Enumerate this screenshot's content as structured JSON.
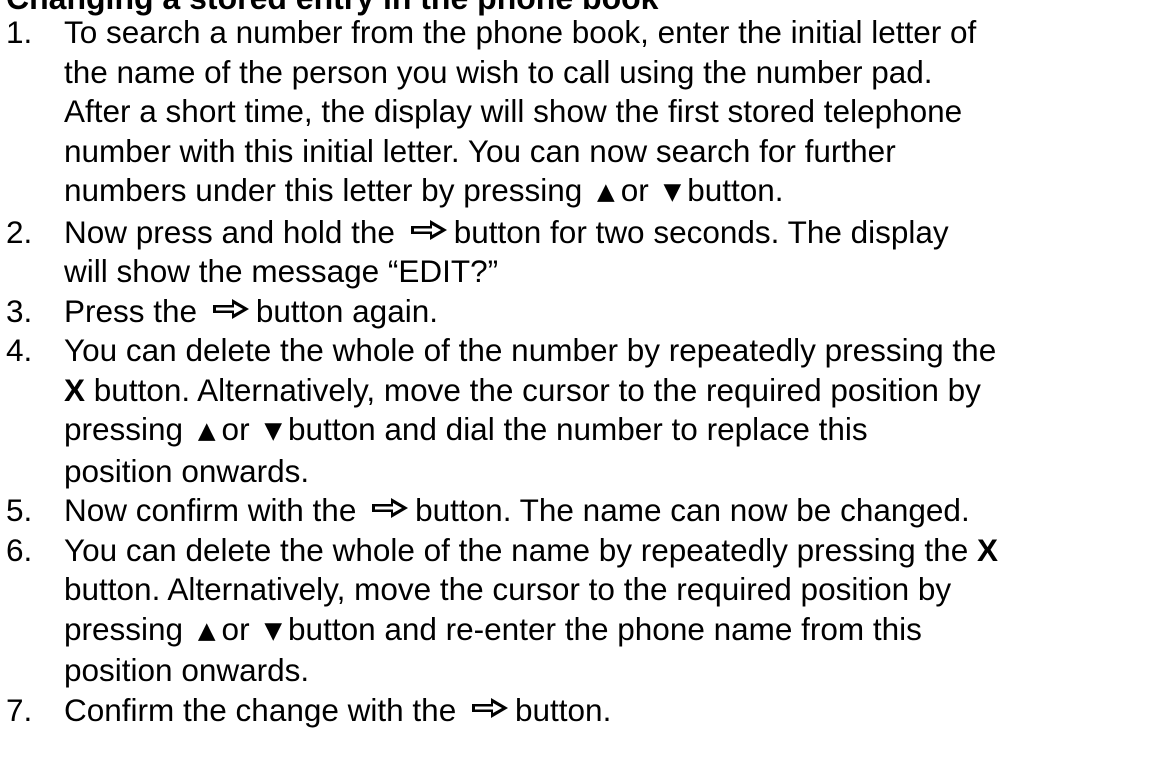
{
  "heading": "Changing a stored entry in the phone book",
  "steps": [
    {
      "num": "1.",
      "l1": "To search a number from the phone book, enter the initial letter of",
      "l2": "the name of the person you wish to call using the number pad.",
      "l3": "After a short time, the display will show the first stored telephone",
      "l4": "number with this initial letter. You can now search for further",
      "l5a": "numbers under this letter by pressing",
      "l5b": "or",
      "l5c": "button."
    },
    {
      "num": "2.",
      "l1a": "Now press and hold the",
      "l1b": "button for two seconds. The display",
      "l2": "will show the message “EDIT?”"
    },
    {
      "num": "3.",
      "l1a": "Press the",
      "l1b": "button again."
    },
    {
      "num": "4.",
      "l1": "You can delete the whole of the number by repeatedly pressing the",
      "l2key": "X",
      "l2": "button. Alternatively, move the cursor to the required position by",
      "l3a": "pressing",
      "l3b": "or",
      "l3c": "button and dial the number to replace this",
      "l4": "position onwards."
    },
    {
      "num": "5.",
      "l1a": "Now confirm with the",
      "l1b": "button. The name can now be changed."
    },
    {
      "num": "6.",
      "l1": "You can delete the whole of the name by repeatedly pressing the",
      "l1key": "X",
      "l2": "button. Alternatively, move the cursor to the required position by",
      "l3a": "pressing",
      "l3b": "or",
      "l3c": "button and re-enter the phone name from this",
      "l4": "position onwards."
    },
    {
      "num": "7.",
      "l1a": "Confirm the change with the",
      "l1b": "button."
    }
  ],
  "icons": {
    "up": "up-triangle-icon",
    "down": "down-triangle-icon",
    "confirm": "confirm-arrow-icon"
  }
}
